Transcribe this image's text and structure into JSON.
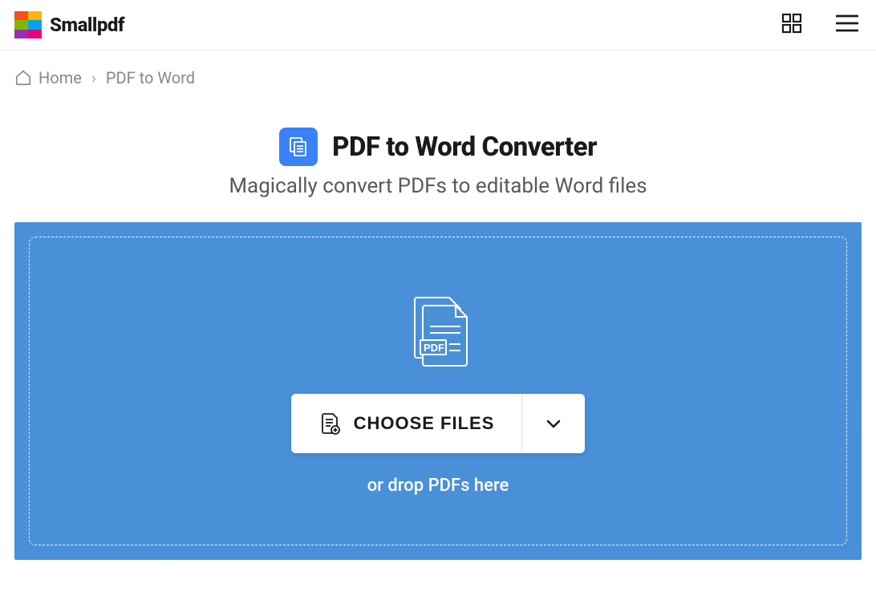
{
  "header": {
    "brand": "Smallpdf"
  },
  "breadcrumb": {
    "home": "Home",
    "separator": "›",
    "current": "PDF to Word"
  },
  "page": {
    "title": "PDF to Word Converter",
    "subtitle": "Magically convert PDFs to editable Word files"
  },
  "dropzone": {
    "choose_label": "CHOOSE FILES",
    "hint": "or drop PDFs here",
    "pdf_badge": "PDF"
  }
}
